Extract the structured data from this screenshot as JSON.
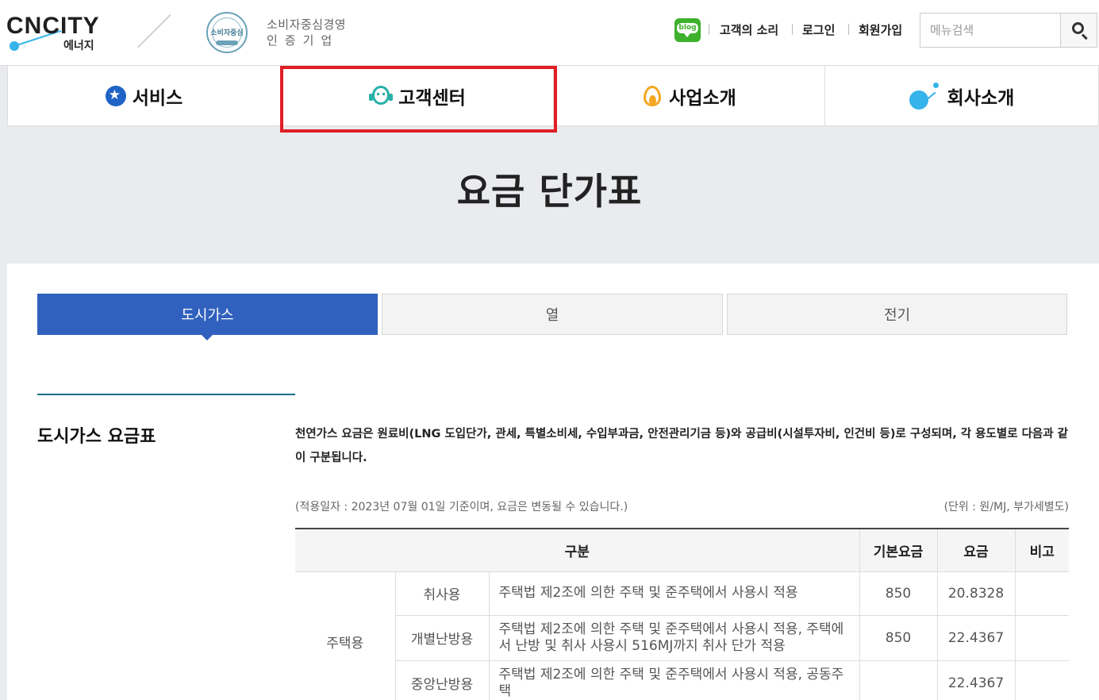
{
  "header": {
    "logo_text": "CNCITY",
    "logo_sub": "에너지",
    "cert_badge_text": "소비자중심",
    "cert_line1": "소비자중심경영",
    "cert_line2": "인증기업",
    "blog_label": "blog",
    "links": [
      "고객의 소리",
      "로그인",
      "회원가입"
    ],
    "search_placeholder": "메뉴검색"
  },
  "nav": {
    "items": [
      {
        "label": "서비스",
        "icon": "star-icon"
      },
      {
        "label": "고객센터",
        "icon": "headset-icon"
      },
      {
        "label": "사업소개",
        "icon": "flame-icon"
      },
      {
        "label": "회사소개",
        "icon": "planet-icon"
      }
    ],
    "highlighted": "고객센터"
  },
  "page": {
    "title": "요금 단가표"
  },
  "tabs": [
    {
      "label": "도시가스",
      "active": true
    },
    {
      "label": "열",
      "active": false
    },
    {
      "label": "전기",
      "active": false
    }
  ],
  "section": {
    "title": "도시가스 요금표",
    "description": "천연가스 요금은 원료비(LNG 도입단가, 관세, 특별소비세, 수입부과금, 안전관리기금 등)와 공급비(시설투자비, 인건비 등)로 구성되며, 각 용도별로 다음과 같이 구분됩니다.",
    "note_left": "(적용일자 : 2023년 07월 01일 기준이며, 요금은 변동될 수 있습니다.)",
    "note_right": "(단위 : 원/MJ, 부가세별도)"
  },
  "table": {
    "headers": [
      "구분",
      "기본요금",
      "요금",
      "비고"
    ],
    "group": "주택용",
    "rows": [
      {
        "type": "취사용",
        "desc": "주택법 제2조에 의한 주택 및 준주택에서 사용시 적용",
        "base": "850",
        "rate": "20.8328",
        "note": ""
      },
      {
        "type": "개별난방용",
        "desc": "주택법 제2조에 의한 주택 및 준주택에서 사용시 적용, 주택에서 난방 및 취사 사용시 516MJ까지 취사 단가 적용",
        "base": "850",
        "rate": "22.4367",
        "note": ""
      },
      {
        "type": "중앙난방용",
        "desc": "주택법 제2조에 의한 주택 및 준주택에서 사용시 적용, 공동주택",
        "base": "",
        "rate": "22.4367",
        "note": ""
      }
    ]
  },
  "colors": {
    "accent_blue": "#3161be",
    "highlight_red": "#e01e24",
    "teal": "#26b0a8",
    "orange": "#f5a623",
    "sky": "#35b3ea"
  }
}
